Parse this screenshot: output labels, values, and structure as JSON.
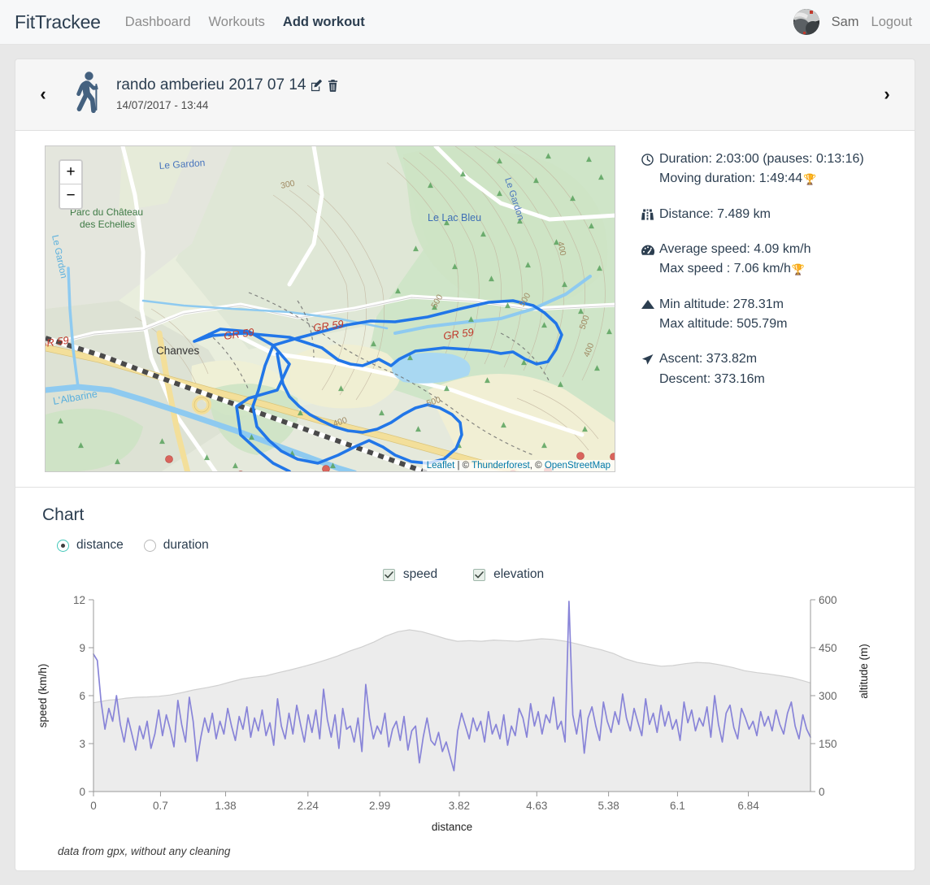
{
  "nav": {
    "brand": "FitTrackee",
    "links": [
      {
        "label": "Dashboard",
        "active": false
      },
      {
        "label": "Workouts",
        "active": false
      },
      {
        "label": "Add workout",
        "active": true
      }
    ],
    "user_name": "Sam",
    "logout_label": "Logout"
  },
  "workout": {
    "prev_label": "‹",
    "next_label": "›",
    "title": "rando amberieu 2017 07 14",
    "date": "14/07/2017 - 13:44",
    "sport_icon": "hiking-icon",
    "edit_icon": "edit-icon",
    "delete_icon": "trash-icon"
  },
  "map": {
    "zoom_in_label": "+",
    "zoom_out_label": "−",
    "attribution": {
      "leaflet": "Leaflet",
      "sep1": " | © ",
      "thunderforest": "Thunderforest",
      "sep2": ", © ",
      "osm": "OpenStreetMap"
    },
    "labels": [
      "Le Gardon",
      "Le Lac Bleu",
      "Parc du Château",
      "des Echelles",
      "Chanves",
      "L'Albarine",
      "Le Gardon",
      "GR 59",
      "GR 59",
      "GR 59",
      "300",
      "400",
      "500",
      "500",
      "400"
    ],
    "track_color": "#2176e8"
  },
  "stats": {
    "groups": [
      {
        "icon": "clock-icon",
        "lines": [
          {
            "text": "Duration: 2:03:00 (pauses: 0:13:16)",
            "trophy": false
          },
          {
            "text": "Moving duration: 1:49:44",
            "trophy": true
          }
        ]
      },
      {
        "icon": "road-icon",
        "lines": [
          {
            "text": "Distance: 7.489 km",
            "trophy": false
          }
        ]
      },
      {
        "icon": "tachometer-icon",
        "lines": [
          {
            "text": "Average speed: 4.09 km/h",
            "trophy": false
          },
          {
            "text": "Max speed : 7.06 km/h",
            "trophy": true
          }
        ]
      },
      {
        "icon": "mountain-icon",
        "lines": [
          {
            "text": "Min altitude: 278.31m",
            "trophy": false
          },
          {
            "text": "Max altitude: 505.79m",
            "trophy": false
          }
        ]
      },
      {
        "icon": "location-arrow-icon",
        "lines": [
          {
            "text": "Ascent: 373.82m",
            "trophy": false
          },
          {
            "text": "Descent: 373.16m",
            "trophy": false
          }
        ]
      }
    ]
  },
  "chart": {
    "heading": "Chart",
    "x_options": [
      {
        "label": "distance",
        "selected": true
      },
      {
        "label": "duration",
        "selected": false
      }
    ],
    "series_toggles": [
      {
        "label": "speed",
        "checked": true
      },
      {
        "label": "elevation",
        "checked": true
      }
    ],
    "note": "data from gpx, without any cleaning",
    "accent_color": "#41c7b9"
  },
  "chart_data": {
    "type": "line",
    "title": "Chart",
    "xlabel": "distance",
    "ylabel": "speed (km/h)",
    "y2label": "altitude (m)",
    "xticks": [
      0,
      0.7,
      1.38,
      2.24,
      2.99,
      3.82,
      4.63,
      5.38,
      6.1,
      6.84
    ],
    "xtick_labels": [
      "0",
      "0.7",
      "1.38",
      "2.24",
      "2.99",
      "3.82",
      "4.63",
      "5.38",
      "6.1",
      "6.84"
    ],
    "xlim": [
      0,
      7.489
    ],
    "yticks": [
      0,
      3,
      6,
      9,
      12
    ],
    "ytick_labels": [
      "0",
      "3",
      "6",
      "9",
      "12"
    ],
    "ylim": [
      0,
      12
    ],
    "y2ticks": [
      0,
      150,
      300,
      450,
      600
    ],
    "y2tick_labels": [
      "0",
      "150",
      "300",
      "450",
      "600"
    ],
    "y2lim": [
      0,
      600
    ],
    "grid": false,
    "legend": "top-center",
    "series": [
      {
        "name": "elevation",
        "axis": "right",
        "kind": "area",
        "color": "#d0d0d0",
        "fill": "#ececec",
        "x": [
          0,
          0.08,
          0.16,
          0.25,
          0.34,
          0.45,
          0.56,
          0.68,
          0.8,
          0.93,
          1.05,
          1.18,
          1.3,
          1.42,
          1.55,
          1.68,
          1.8,
          1.93,
          2.05,
          2.18,
          2.3,
          2.43,
          2.55,
          2.68,
          2.8,
          2.93,
          3.05,
          3.18,
          3.3,
          3.43,
          3.55,
          3.68,
          3.8,
          3.93,
          4.05,
          4.18,
          4.3,
          4.43,
          4.55,
          4.68,
          4.8,
          4.93,
          5.05,
          5.18,
          5.3,
          5.43,
          5.55,
          5.68,
          5.8,
          5.93,
          6.05,
          6.18,
          6.3,
          6.43,
          6.55,
          6.68,
          6.8,
          6.93,
          7.05,
          7.18,
          7.3,
          7.42,
          7.489
        ],
        "values": [
          278,
          282,
          286,
          288,
          292,
          295,
          296,
          298,
          302,
          310,
          318,
          325,
          332,
          342,
          352,
          358,
          362,
          372,
          380,
          390,
          400,
          412,
          424,
          440,
          452,
          468,
          486,
          500,
          506,
          500,
          490,
          478,
          470,
          472,
          470,
          474,
          472,
          470,
          474,
          478,
          476,
          470,
          462,
          452,
          444,
          432,
          416,
          404,
          398,
          392,
          394,
          400,
          404,
          402,
          396,
          388,
          378,
          372,
          368,
          362,
          356,
          346,
          340
        ]
      },
      {
        "name": "speed",
        "axis": "left",
        "kind": "line",
        "color": "#8884d8",
        "values_note": "noisy per-point GPS speed, 0–12 km/h range, mean ~4.1",
        "values": [
          8.6,
          8.2,
          5.6,
          3.9,
          5.2,
          4.4,
          6.0,
          4.2,
          3.1,
          4.6,
          3.6,
          2.6,
          4.1,
          3.3,
          4.4,
          2.7,
          3.6,
          5.1,
          3.5,
          4.8,
          3.9,
          2.8,
          5.7,
          4.2,
          3.1,
          5.9,
          4.4,
          1.9,
          3.4,
          4.6,
          3.7,
          4.9,
          3.3,
          4.4,
          3.6,
          5.2,
          4.1,
          3.2,
          4.7,
          3.9,
          5.3,
          3.4,
          4.6,
          3.8,
          5.1,
          3.5,
          4.3,
          2.9,
          5.8,
          4.1,
          3.3,
          4.9,
          3.6,
          5.4,
          4.2,
          3.1,
          4.8,
          3.7,
          5.1,
          3.3,
          6.4,
          4.5,
          3.4,
          4.8,
          2.7,
          5.2,
          3.9,
          4.1,
          3.1,
          4.6,
          2.5,
          6.7,
          4.6,
          3.3,
          4.1,
          3.6,
          4.9,
          2.8,
          3.9,
          4.4,
          3.2,
          4.7,
          2.6,
          3.8,
          4.1,
          1.8,
          3.4,
          4.6,
          3.2,
          2.9,
          3.7,
          2.5,
          3.1,
          2.2,
          1.3,
          3.8,
          4.9,
          4.1,
          3.3,
          4.6,
          3.8,
          4.4,
          3.1,
          5.0,
          3.6,
          4.2,
          3.3,
          4.8,
          2.9,
          4.1,
          3.5,
          5.2,
          4.6,
          3.4,
          5.5,
          4.1,
          5.0,
          3.6,
          4.8,
          4.3,
          5.9,
          3.9,
          4.4,
          3.1,
          11.9,
          4.8,
          3.6,
          5.1,
          2.4,
          4.6,
          5.3,
          4.1,
          3.2,
          5.6,
          4.4,
          3.7,
          5.0,
          4.2,
          6.1,
          4.6,
          3.8,
          5.2,
          4.3,
          3.5,
          5.8,
          4.2,
          4.9,
          3.7,
          5.4,
          4.1,
          5.0,
          3.9,
          4.5,
          3.2,
          5.6,
          4.3,
          5.1,
          3.8,
          4.6,
          4.1,
          5.3,
          3.4,
          6.0,
          4.2,
          3.1,
          4.9,
          5.4,
          4.0,
          3.3,
          5.2,
          4.6,
          3.9,
          4.4,
          3.5,
          5.0,
          4.1,
          4.7,
          3.8,
          5.1,
          4.2,
          3.6,
          4.9,
          5.6,
          4.1,
          3.3,
          4.8,
          3.9,
          3.4
        ]
      }
    ]
  }
}
